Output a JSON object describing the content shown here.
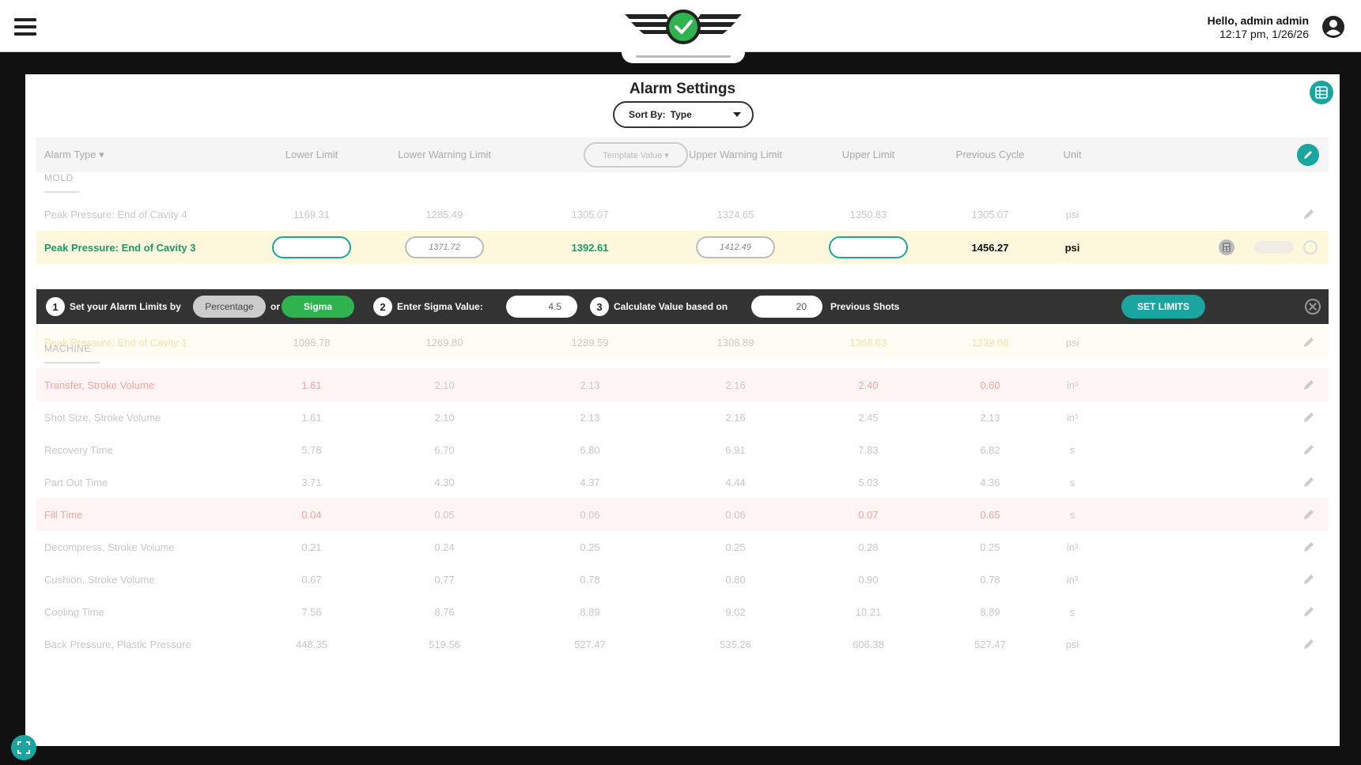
{
  "header": {
    "greeting": "Hello, admin admin",
    "datetime": "12:17 pm, 1/26/26"
  },
  "page": {
    "title": "Alarm Settings",
    "sort_label": "Sort By:",
    "sort_value": "Type"
  },
  "table": {
    "columns": {
      "alarm_type": "Alarm Type ▾",
      "lower_limit": "Lower Limit",
      "lower_warning": "Lower Warning Limit",
      "template_value": "Template Value ▾",
      "upper_warning": "Upper Warning Limit",
      "upper_limit": "Upper Limit",
      "previous_cycle": "Previous Cycle",
      "unit": "Unit"
    },
    "sections": {
      "mold": "MOLD",
      "machine": "MACHINE"
    },
    "mold_rows": [
      {
        "name": "Peak Pressure: End of Cavity 4",
        "lower": "1169.31",
        "lower_warn": "1285.49",
        "template": "1305.07",
        "upper_warn": "1324.65",
        "upper": "1350.83",
        "prev": "1305.07",
        "unit": "psi"
      },
      {
        "name": "Peak Pressure: End of Cavity 3",
        "lower": "",
        "lower_warn": "1371.72",
        "template": "1392.61",
        "upper_warn": "1412.49",
        "upper": "",
        "prev": "1456.27",
        "unit": "psi"
      },
      {
        "name": "Peak Pressure: End of Cavity 1",
        "lower": "1098.78",
        "lower_warn": "1269.80",
        "template": "1289.59",
        "upper_warn": "1308.89",
        "upper": "1368.63",
        "prev": "1339.08",
        "unit": "psi"
      }
    ],
    "machine_rows": [
      {
        "name": "Transfer, Stroke Volume",
        "lower": "1.61",
        "lower_warn": "2.10",
        "template": "2.13",
        "upper_warn": "2.16",
        "upper": "2.40",
        "prev": "0.60",
        "unit": "in³"
      },
      {
        "name": "Shot Size, Stroke Volume",
        "lower": "1.61",
        "lower_warn": "2.10",
        "template": "2.13",
        "upper_warn": "2.16",
        "upper": "2.45",
        "prev": "2.13",
        "unit": "in³"
      },
      {
        "name": "Recovery Time",
        "lower": "5.78",
        "lower_warn": "6.70",
        "template": "6.80",
        "upper_warn": "6.91",
        "upper": "7.83",
        "prev": "6.82",
        "unit": "s"
      },
      {
        "name": "Part Out Time",
        "lower": "3.71",
        "lower_warn": "4.30",
        "template": "4.37",
        "upper_warn": "4.44",
        "upper": "5.03",
        "prev": "4.36",
        "unit": "s"
      },
      {
        "name": "Fill Time",
        "lower": "0.04",
        "lower_warn": "0.05",
        "template": "0.06",
        "upper_warn": "0.06",
        "upper": "0.07",
        "prev": "0.65",
        "unit": "s"
      },
      {
        "name": "Decompress, Stroke Volume",
        "lower": "0.21",
        "lower_warn": "0.24",
        "template": "0.25",
        "upper_warn": "0.25",
        "upper": "0.28",
        "prev": "0.25",
        "unit": "in³"
      },
      {
        "name": "Cushion, Stroke Volume",
        "lower": "0.67",
        "lower_warn": "0.77",
        "template": "0.78",
        "upper_warn": "0.80",
        "upper": "0.90",
        "prev": "0.78",
        "unit": "in³"
      },
      {
        "name": "Cooling Time",
        "lower": "7.56",
        "lower_warn": "8.76",
        "template": "8.89",
        "upper_warn": "9.02",
        "upper": "10.21",
        "prev": "8.89",
        "unit": "s"
      },
      {
        "name": "Back Pressure, Plastic Pressure",
        "lower": "448.35",
        "lower_warn": "519.56",
        "template": "527.47",
        "upper_warn": "535.26",
        "upper": "606.38",
        "prev": "527.47",
        "unit": "psi"
      }
    ]
  },
  "sigma_bar": {
    "step1": "1",
    "step1_text": "Set your Alarm Limits by",
    "percentage": "Percentage",
    "or": "or",
    "sigma": "Sigma",
    "step2": "2",
    "step2_text": "Enter Sigma Value:",
    "sigma_value": "4.5",
    "step3": "3",
    "step3_text": "Calculate Value based on",
    "shots_value": "20",
    "shots_text": "Previous Shots",
    "set_limits": "SET LIMITS"
  },
  "colors": {
    "accent": "#1ba5a0",
    "green": "#2eb34f",
    "highlight_row": "#fdf7dc",
    "alarm_red": "#f5a3a3"
  }
}
